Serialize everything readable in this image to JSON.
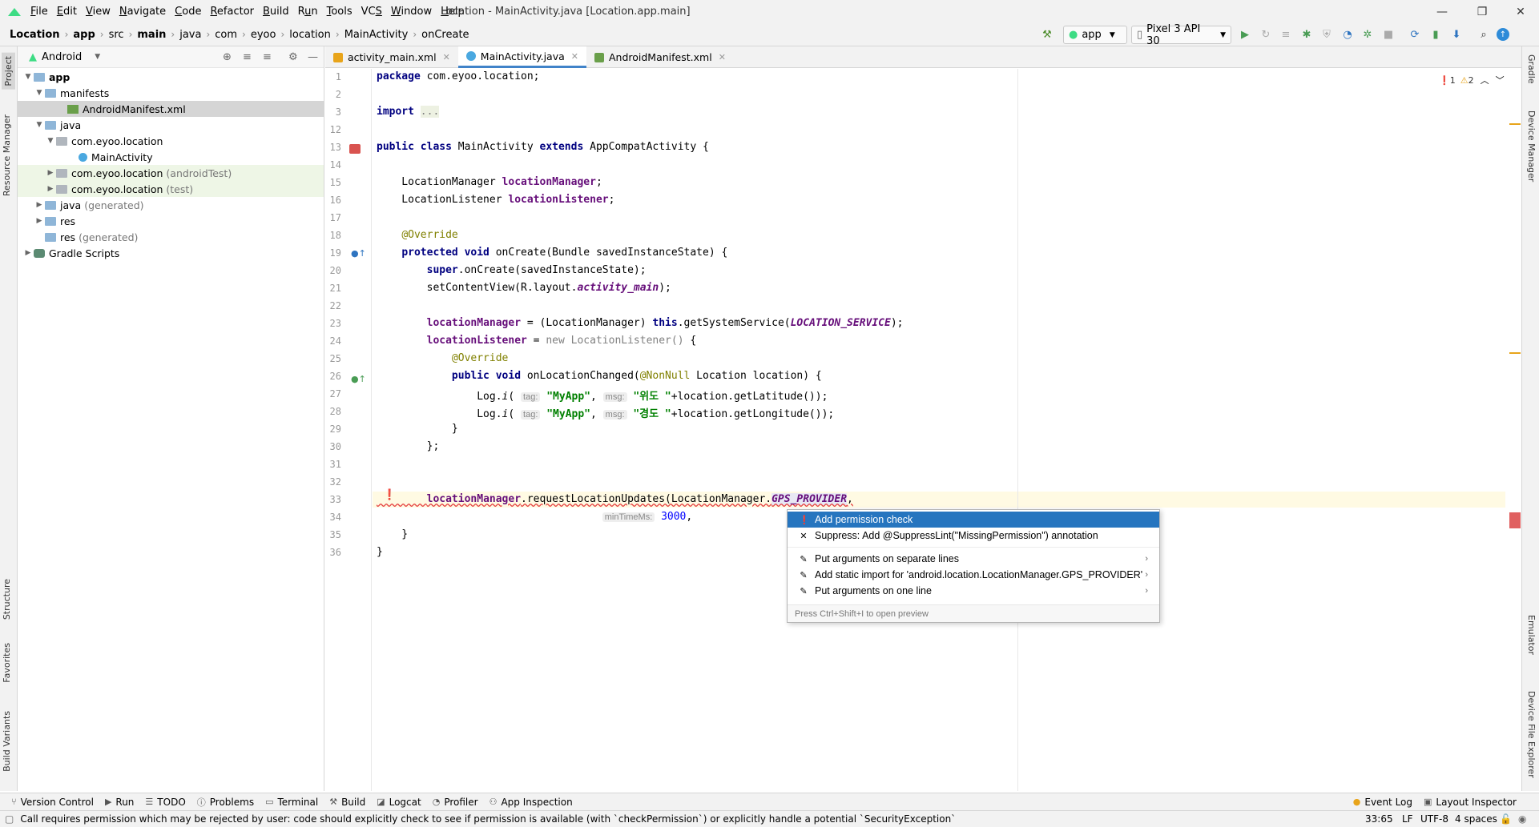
{
  "menu": {
    "items": [
      {
        "label": "File",
        "u": "F"
      },
      {
        "label": "Edit",
        "u": "E"
      },
      {
        "label": "View",
        "u": "V"
      },
      {
        "label": "Navigate",
        "u": "N"
      },
      {
        "label": "Code",
        "u": "C"
      },
      {
        "label": "Refactor",
        "u": "R"
      },
      {
        "label": "Build",
        "u": "B"
      },
      {
        "label": "Run",
        "u": "u"
      },
      {
        "label": "Tools",
        "u": "T"
      },
      {
        "label": "VCS",
        "u": "S"
      },
      {
        "label": "Window",
        "u": "W"
      },
      {
        "label": "Help",
        "u": "H"
      }
    ],
    "window_title": "Location - MainActivity.java [Location.app.main]"
  },
  "breadcrumb": [
    "Location",
    "app",
    "src",
    "main",
    "java",
    "com",
    "eyoo",
    "location",
    "MainActivity",
    "onCreate"
  ],
  "toolbar": {
    "run_config": "app",
    "device": "Pixel 3 API 30"
  },
  "project_panel": {
    "view": "Android",
    "tree": [
      {
        "label": "app",
        "extra": "",
        "bold": true
      },
      {
        "label": "manifests",
        "extra": ""
      },
      {
        "label": "AndroidManifest.xml",
        "extra": ""
      },
      {
        "label": "java",
        "extra": ""
      },
      {
        "label": "com.eyoo.location",
        "extra": ""
      },
      {
        "label": "MainActivity",
        "extra": ""
      },
      {
        "label": "com.eyoo.location",
        "extra": "(androidTest)"
      },
      {
        "label": "com.eyoo.location",
        "extra": "(test)"
      },
      {
        "label": "java",
        "extra": "(generated)"
      },
      {
        "label": "res",
        "extra": ""
      },
      {
        "label": "res",
        "extra": "(generated)"
      },
      {
        "label": "Gradle Scripts",
        "extra": ""
      }
    ]
  },
  "side_tabs": {
    "left": [
      "Project",
      "Resource Manager",
      "Structure",
      "Favorites",
      "Build Variants"
    ],
    "right": [
      "Gradle",
      "Device Manager",
      "Emulator",
      "Device File Explorer"
    ]
  },
  "editor": {
    "tabs": [
      "activity_main.xml",
      "MainActivity.java",
      "AndroidManifest.xml"
    ],
    "active_tab": "MainActivity.java",
    "line_numbers": [
      "1",
      "2",
      "3",
      "12",
      "13",
      "14",
      "15",
      "16",
      "17",
      "18",
      "19",
      "20",
      "21",
      "22",
      "23",
      "24",
      "25",
      "26",
      "27",
      "28",
      "29",
      "30",
      "31",
      "32",
      "33",
      "34",
      "35",
      "36"
    ],
    "errors": "1",
    "warnings": "2",
    "hints": {
      "tag": "tag:",
      "msg": "msg:",
      "min_time": "minTimeMs:"
    }
  },
  "popup": {
    "items": [
      {
        "label": "Add permission check",
        "icon": "error-bulb-icon",
        "selected": true,
        "submenu": false
      },
      {
        "label": "Suppress: Add @SuppressLint(\"MissingPermission\") annotation",
        "icon": "suppress-icon",
        "selected": false,
        "submenu": false
      },
      {
        "label": "Put arguments on separate lines",
        "icon": "intention-icon",
        "selected": false,
        "submenu": true
      },
      {
        "label": "Add static import for 'android.location.LocationManager.GPS_PROVIDER'",
        "icon": "intention-icon",
        "selected": false,
        "submenu": true
      },
      {
        "label": "Put arguments on one line",
        "icon": "intention-icon",
        "selected": false,
        "submenu": true
      }
    ],
    "footer": "Press Ctrl+Shift+I to open preview"
  },
  "bottom_tools": [
    "Version Control",
    "Run",
    "TODO",
    "Problems",
    "Terminal",
    "Build",
    "Logcat",
    "Profiler",
    "App Inspection"
  ],
  "bottom_tools_right": [
    "Event Log",
    "Layout Inspector"
  ],
  "status": {
    "message": "Call requires permission which may be rejected by user: code should explicitly check to see if permission is available (with `checkPermission`) or explicitly handle a potential `SecurityException`",
    "position": "33:65",
    "line_sep": "LF",
    "encoding": "UTF-8",
    "indent": "4 spaces"
  },
  "colors": {
    "accent": "#2675bf",
    "error": "#e53e3e",
    "warning": "#e8a41a"
  }
}
